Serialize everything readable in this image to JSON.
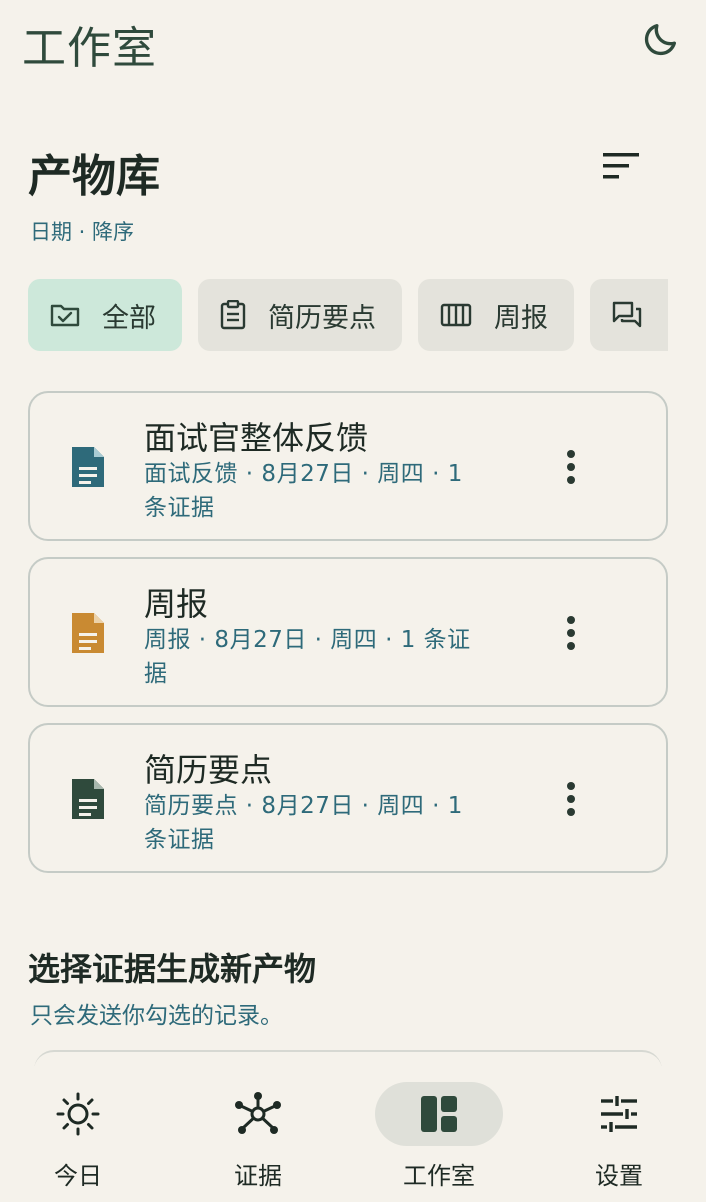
{
  "app_bar": {
    "title": "工作室",
    "theme_icon": "moon-icon"
  },
  "library": {
    "title": "产物库",
    "sort_icon": "sort-icon",
    "sort_caption": "日期 · 降序"
  },
  "chips": [
    {
      "label": "全部",
      "icon": "folder-check-icon",
      "selected": true
    },
    {
      "label": "简历要点",
      "icon": "clipboard-icon",
      "selected": false
    },
    {
      "label": "周报",
      "icon": "calendar-columns-icon",
      "selected": false
    },
    {
      "label": "",
      "icon": "chat-icon",
      "selected": false
    }
  ],
  "artifacts": [
    {
      "title": "面试官整体反馈",
      "meta": "面试反馈 · 8月27日 · 周四 · 1 条证据",
      "icon": "document-icon",
      "icon_color": "#2e6a7a"
    },
    {
      "title": "周报",
      "meta": "周报 · 8月27日 · 周四 · 1 条证据",
      "icon": "document-icon",
      "icon_color": "#c98a32"
    },
    {
      "title": "简历要点",
      "meta": "简历要点 · 8月27日 · 周四 · 1 条证据",
      "icon": "document-icon",
      "icon_color": "#2f4a3c"
    }
  ],
  "generate": {
    "title": "选择证据生成新产物",
    "subtitle": "只会发送你勾选的记录。"
  },
  "bottom_nav": [
    {
      "label": "今日",
      "icon": "sun-icon",
      "active": false
    },
    {
      "label": "证据",
      "icon": "network-icon",
      "active": false
    },
    {
      "label": "工作室",
      "icon": "dashboard-icon",
      "active": true
    },
    {
      "label": "设置",
      "icon": "sliders-icon",
      "active": false
    }
  ],
  "colors": {
    "background": "#f5f2eb",
    "accent_text": "#2e6a7a",
    "selected_chip": "#cde8da",
    "chip": "#e4e3dc",
    "dark_green": "#2f4a3c",
    "orange": "#c98a32"
  }
}
